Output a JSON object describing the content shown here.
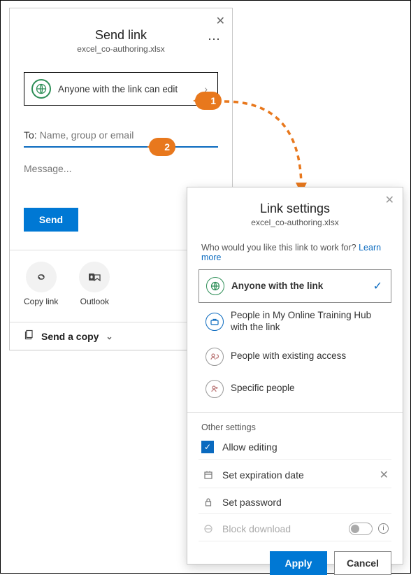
{
  "send": {
    "title": "Send link",
    "subtitle": "excel_co-authoring.xlsx",
    "permission_text": "Anyone with the link can edit",
    "to_label": "To:",
    "to_placeholder": "Name, group or email",
    "message_placeholder": "Message...",
    "send_btn": "Send",
    "copy_link": "Copy link",
    "outlook": "Outlook",
    "send_copy": "Send a copy"
  },
  "callouts": {
    "one": "1",
    "two": "2"
  },
  "settings": {
    "title": "Link settings",
    "subtitle": "excel_co-authoring.xlsx",
    "prompt": "Who would you like this link to work for?",
    "learn_more": "Learn more",
    "options": [
      {
        "label": "Anyone with the link",
        "selected": true
      },
      {
        "label": "People in My Online Training Hub with the link",
        "selected": false
      },
      {
        "label": "People with existing access",
        "selected": false
      },
      {
        "label": "Specific people",
        "selected": false
      }
    ],
    "other_header": "Other settings",
    "allow_editing": "Allow editing",
    "expiration": "Set expiration date",
    "password": "Set password",
    "block_download": "Block download",
    "apply": "Apply",
    "cancel": "Cancel"
  }
}
